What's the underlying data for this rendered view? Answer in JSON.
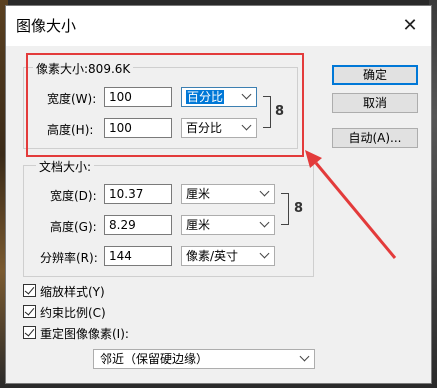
{
  "dialog": {
    "title": "图像大小",
    "close_glyph": "✕"
  },
  "pixel_size": {
    "legend": "像素大小:809.6K",
    "width_label": "宽度(W):",
    "width_value": "100",
    "width_unit": "百分比",
    "height_label": "高度(H):",
    "height_value": "100",
    "height_unit": "百分比"
  },
  "document_size": {
    "legend": "文档大小:",
    "width_label": "宽度(D):",
    "width_value": "10.37",
    "width_unit": "厘米",
    "height_label": "高度(G):",
    "height_value": "8.29",
    "height_unit": "厘米",
    "resolution_label": "分辨率(R):",
    "resolution_value": "144",
    "resolution_unit": "像素/英寸"
  },
  "buttons": {
    "ok": "确定",
    "cancel": "取消",
    "auto": "自动(A)..."
  },
  "options": {
    "scale_styles": "缩放样式(Y)",
    "constrain_proportions": "约束比例(C)",
    "resample": "重定图像像素(I):",
    "resample_method": "邻近（保留硬边缘）"
  },
  "colors": {
    "annotation": "#e33b3b",
    "selection": "#0078d7"
  },
  "icons": {
    "link": "chain-link-icon",
    "checkbox": "checkmark-icon",
    "dropdown": "chevron-down-icon"
  }
}
